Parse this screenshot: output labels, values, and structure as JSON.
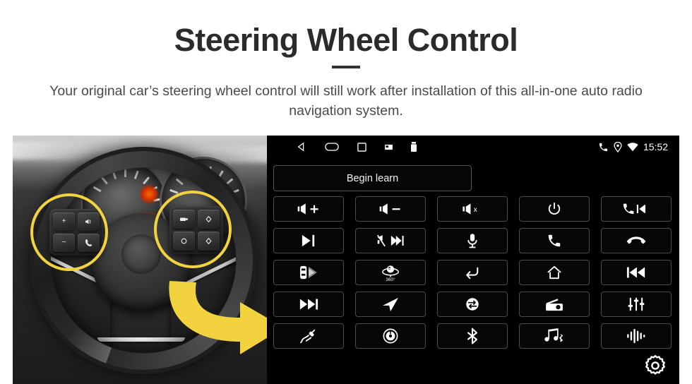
{
  "header": {
    "title": "Steering Wheel Control",
    "subtitle": "Your original car’s steering wheel control will still work after installation of this all-in-one auto radio navigation system."
  },
  "colors": {
    "highlight_yellow": "#F2D33F",
    "title_color": "#2b2b2b",
    "subtitle_color": "#4a4a4a",
    "panel_background": "#000000",
    "button_border": "#4a4a4a"
  },
  "photo": {
    "description": "steering-wheel-photo",
    "highlight_circles": 2,
    "arrow": "yellow-curved-right-arrow",
    "left_pad_keys": [
      "+",
      "voice",
      "−",
      "call"
    ],
    "right_pad_keys": [
      "media",
      "up",
      "menu",
      "down"
    ]
  },
  "unit": {
    "statusbar": {
      "left_icons": [
        "back-icon",
        "home-icon",
        "recents-icon",
        "sd-card-icon",
        "usb-icon"
      ],
      "right_icons": [
        "phone-icon",
        "location-icon",
        "wifi-icon"
      ],
      "time": "15:52"
    },
    "begin_learn_label": "Begin learn",
    "settings_icon": "gear-icon",
    "buttons": [
      {
        "name": "volume-up",
        "icon": "speaker-plus-icon",
        "label": ""
      },
      {
        "name": "volume-down",
        "icon": "speaker-minus-icon",
        "label": ""
      },
      {
        "name": "mute",
        "icon": "speaker-x-icon",
        "label": ""
      },
      {
        "name": "power",
        "icon": "power-icon",
        "label": ""
      },
      {
        "name": "call-previous",
        "icon": "phone-previous-icon",
        "label": ""
      },
      {
        "name": "play-pause",
        "icon": "play-pause-icon",
        "label": ""
      },
      {
        "name": "mute-next",
        "icon": "mute-next-icon",
        "label": ""
      },
      {
        "name": "voice-mic",
        "icon": "microphone-icon",
        "label": ""
      },
      {
        "name": "answer-call",
        "icon": "phone-icon",
        "label": ""
      },
      {
        "name": "hang-up",
        "icon": "phone-hangup-icon",
        "label": ""
      },
      {
        "name": "parking-sensor",
        "icon": "car-radar-icon",
        "label": ""
      },
      {
        "name": "camera-360",
        "icon": "camera-360-icon",
        "label": "360°"
      },
      {
        "name": "back",
        "icon": "back-arrow-icon",
        "label": ""
      },
      {
        "name": "home",
        "icon": "home-icon",
        "label": ""
      },
      {
        "name": "previous-track",
        "icon": "previous-track-icon",
        "label": ""
      },
      {
        "name": "next-track",
        "icon": "next-track-icon",
        "label": ""
      },
      {
        "name": "navigation",
        "icon": "navigation-arrow-icon",
        "label": ""
      },
      {
        "name": "source-switch",
        "icon": "swap-circle-icon",
        "label": ""
      },
      {
        "name": "radio",
        "icon": "radio-icon",
        "label": ""
      },
      {
        "name": "equalizer",
        "icon": "equalizer-icon",
        "label": ""
      },
      {
        "name": "aux-input",
        "icon": "cable-plug-icon",
        "label": ""
      },
      {
        "name": "disc-player",
        "icon": "disc-icon",
        "label": ""
      },
      {
        "name": "bluetooth",
        "icon": "bluetooth-icon",
        "label": ""
      },
      {
        "name": "bluetooth-music",
        "icon": "music-note-bt-icon",
        "label": ""
      },
      {
        "name": "sound-wave",
        "icon": "waveform-icon",
        "label": ""
      }
    ]
  }
}
